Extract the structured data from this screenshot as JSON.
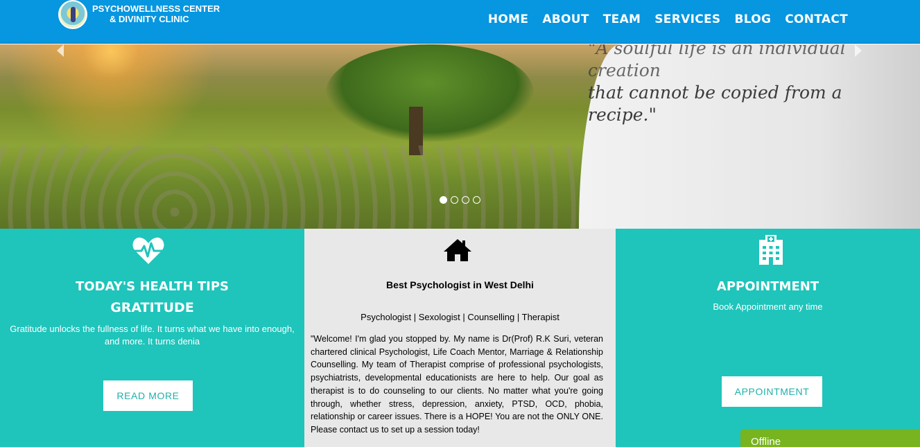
{
  "header": {
    "brand_line1": "PSYCHOWELLNESS CENTER",
    "brand_line2": "& DIVINITY CLINIC",
    "logo_icon": "clinic-logo",
    "nav": [
      {
        "label": "HOME"
      },
      {
        "label": "ABOUT"
      },
      {
        "label": "TEAM"
      },
      {
        "label": "SERVICES"
      },
      {
        "label": "BLOG"
      },
      {
        "label": "CONTACT"
      }
    ]
  },
  "hero": {
    "quote_line1": "\"A soulful life is an individual creation",
    "quote_line2": "that cannot be copied from a recipe.\"",
    "slide_count": 4,
    "active_slide": 1
  },
  "tips": {
    "icon": "heartbeat-icon",
    "title": "TODAY'S HEALTH TIPS",
    "subtitle": "GRATITUDE",
    "text": "Gratitude unlocks the fullness of life. It turns what we have into enough, and more. It turns denia",
    "button": "READ MORE"
  },
  "about": {
    "icon": "home-icon",
    "title": "Best Psychologist in West Delhi",
    "tags": "Psychologist | Sexologist | Counselling | Therapist",
    "body": "\"Welcome! I'm glad you stopped by. My name is Dr(Prof) R.K Suri, veteran chartered clinical Psychologist, Life Coach Mentor, Marriage & Relationship Counselling. My team of Therapist comprise of professional psychologists, psychiatrists, developmental educationists are here to help. Our goal as therapist is to do counseling to our clients. No matter what you're going through, whether stress, depression, anxiety, PTSD, OCD, phobia, relationship or career issues. There is a HOPE! You are not the ONLY ONE. Please contact us to set up a session today!"
  },
  "appointment": {
    "icon": "hospital-icon",
    "title": "APPOINTMENT",
    "subtitle": "Book Appointment any time",
    "button": "APPOINTMENT"
  },
  "chat": {
    "status": "Offline"
  },
  "colors": {
    "header_bg": "#0796e0",
    "teal": "#1fc4bb",
    "panel_grey": "#e8e8e8",
    "chat_green": "#77b41f"
  }
}
